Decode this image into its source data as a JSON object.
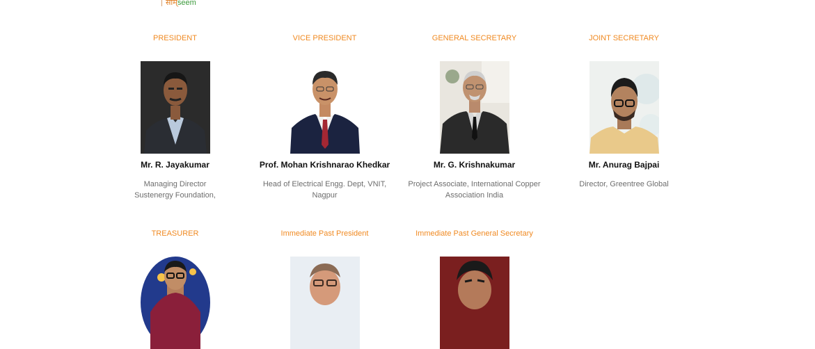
{
  "logo": {
    "hindi": "सीम्",
    "english": "seem"
  },
  "members": [
    {
      "role": "PRESIDENT",
      "name": "Mr. R. Jayakumar",
      "desc": [
        "Managing Director",
        "Sustenergy Foundation,"
      ]
    },
    {
      "role": "VICE PRESIDENT",
      "name": "Prof. Mohan Krishnarao Khedkar",
      "desc": [
        "Head of Electrical Engg. Dept, VNIT,",
        "Nagpur"
      ]
    },
    {
      "role": "GENERAL SECRETARY",
      "name": "Mr. G. Krishnakumar",
      "desc": [
        "Project Associate, International Copper",
        "Association India"
      ]
    },
    {
      "role": "JOINT SECRETARY",
      "name": "Mr. Anurag Bajpai",
      "desc": [
        "Director, Greentree Global",
        ""
      ]
    },
    {
      "role": "TREASURER"
    },
    {
      "role": "Immediate Past President"
    },
    {
      "role": "Immediate Past General Secretary"
    }
  ]
}
